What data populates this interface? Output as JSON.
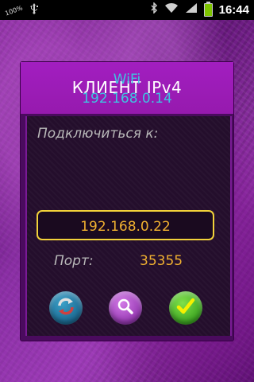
{
  "status_bar": {
    "battery_percent": "100%",
    "time": "16:44",
    "icons": [
      "usb-icon",
      "bluetooth-icon",
      "wifi-icon",
      "signal-icon",
      "battery-icon"
    ]
  },
  "dialog": {
    "title": "КЛИЕНТ IPv4",
    "connection_type": "WiFi",
    "local_ip": "192.168.0.14",
    "connect_label": "Подключиться к:",
    "server_ip_value": "192.168.0.22",
    "port_label": "Порт:",
    "port_value": "35355",
    "buttons": {
      "refresh": "refresh-icon",
      "search": "search-icon",
      "ok": "checkmark-icon"
    }
  },
  "colors": {
    "background": "#8a2aa0",
    "header": "#a21ec0",
    "panel": "#240e2c",
    "accent_cyan": "#3fc3e0",
    "accent_orange": "#f0b030",
    "input_border": "#f2d23a"
  }
}
